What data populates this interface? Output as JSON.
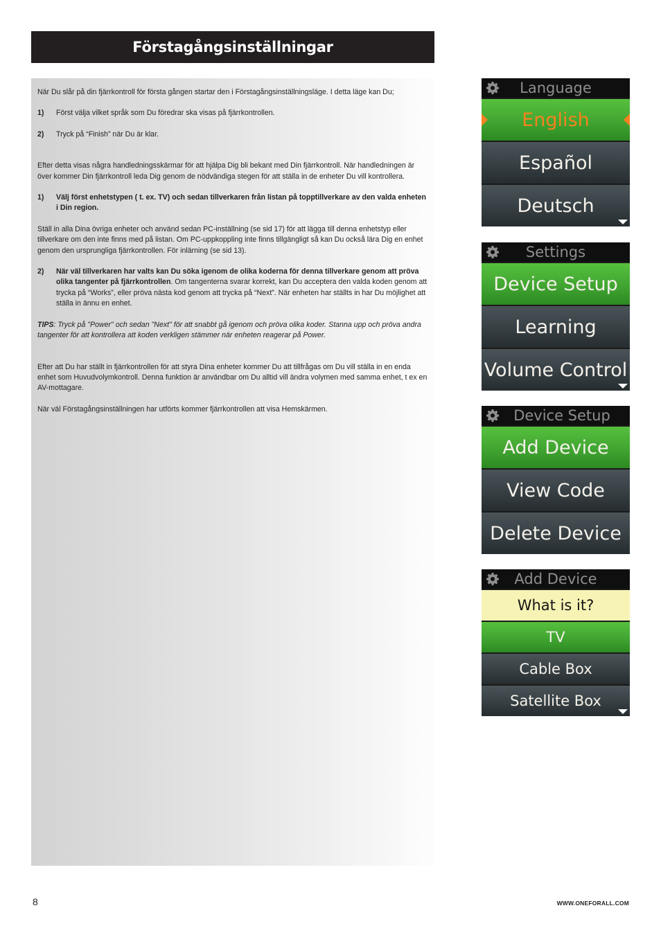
{
  "header": {
    "title": "Förstagångsinställningar"
  },
  "content": {
    "intro": "När Du slår på din fjärrkontroll för första gången startar den i Förstagångsinställningsläge. I detta läge kan Du;",
    "steps_a": [
      {
        "num": "1)",
        "text": "Först välja vilket språk som Du föredrar ska visas på fjärrkontrollen."
      },
      {
        "num": "2)",
        "text": "Tryck på “Finish” när Du är klar."
      }
    ],
    "para2": "Efter detta visas några handledningsskärmar för att hjälpa Dig bli bekant med Din fjärrkontroll. När handledningen är över kommer Din fjärrkontroll leda Dig genom de nödvändiga stegen för att ställa in de enheter Du vill kontrollera.",
    "step_b1": {
      "num": "1)",
      "bold": "Välj först enhetstypen ( t. ex. TV) och sedan tillverkaren från listan på topptillverkare av den valda enheten i Din region."
    },
    "para3": "Ställ in alla Dina övriga enheter och använd sedan PC-inställning (se sid 17) för att lägga till denna enhetstyp eller tillverkare om den inte finns med på listan. Om PC-uppkoppling inte finns tillgängligt så kan Du också lära Dig en enhet genom den ursprungliga fjärrkontrollen. För inlärning (se sid 13).",
    "step_b2": {
      "num": "2)",
      "bold": "När väl tillverkaren har valts kan Du söka igenom de olika koderna för denna tillverkare genom att pröva olika tangenter på fjärrkontrollen",
      "rest": ". Om tangenterna svarar korrekt, kan Du acceptera den valda koden genom att trycka på “Works”, eller pröva nästa kod genom att trycka på “Next”. När enheten har ställts in har Du möjlighet att ställa in ännu en enhet."
    },
    "tips_label": "TIPS",
    "tips_text": ": Tryck på \"Power\" och sedan \"Next\" för att snabbt gå igenom och pröva olika koder. Stanna upp och pröva andra tangenter för att kontrollera att koden verkligen stämmer när enheten reagerar på Power.",
    "para4": "Efter att Du har ställt in fjärrkontrollen för att styra Dina enheter kommer Du att tillfrågas om Du vill ställa in en enda enhet som Huvudvolymkontroll. Denna funktion är användbar om Du alltid vill ändra volymen med samma enhet, t ex en AV-mottagare.",
    "para5": "När väl Förstagångsinställningen har utförts kommer fjärrkontrollen att visa Hemskärmen."
  },
  "screens": [
    {
      "title": "Language",
      "icon": "gear-icon",
      "items": [
        {
          "label": "English",
          "state": "selected"
        },
        {
          "label": "Español",
          "state": "normal"
        },
        {
          "label": "Deutsch",
          "state": "normal"
        }
      ],
      "has_more": true
    },
    {
      "title": "Settings",
      "icon": "gear-icon",
      "items": [
        {
          "label": "Device Setup",
          "state": "highlighted"
        },
        {
          "label": "Learning",
          "state": "normal"
        },
        {
          "label": "Volume Control",
          "state": "normal"
        }
      ],
      "has_more": true
    },
    {
      "title": "Device Setup",
      "icon": "gear-icon",
      "items": [
        {
          "label": "Add Device",
          "state": "highlighted"
        },
        {
          "label": "View Code",
          "state": "normal"
        },
        {
          "label": "Delete Device",
          "state": "normal"
        }
      ],
      "has_more": false
    },
    {
      "title": "Add Device",
      "icon": "gear-icon",
      "prompt": "What is it?",
      "items": [
        {
          "label": "TV",
          "state": "highlighted"
        },
        {
          "label": "Cable Box",
          "state": "normal"
        },
        {
          "label": "Satellite Box",
          "state": "normal"
        }
      ],
      "has_more": true
    }
  ],
  "colors": {
    "title_bar": "#231f20",
    "highlight_green": "#41a531",
    "selected_text_orange": "#f58220",
    "row_dark": "#3a4347",
    "prompt_yellow": "#f6f3b5"
  },
  "footer": {
    "page_number": "8",
    "url": "WWW.ONEFORALL.COM"
  }
}
